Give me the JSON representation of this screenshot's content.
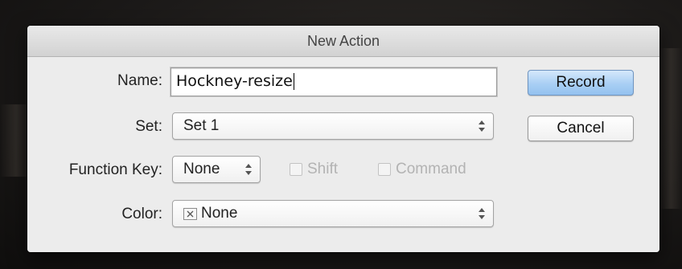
{
  "dialog": {
    "title": "New Action"
  },
  "name_field": {
    "label": "Name:",
    "value": "Hockney-resize"
  },
  "set_field": {
    "label": "Set:",
    "selected": "Set 1"
  },
  "function_key": {
    "label": "Function Key:",
    "selected": "None",
    "shift_label": "Shift",
    "shift_checked": false,
    "command_label": "Command",
    "command_checked": false
  },
  "color_field": {
    "label": "Color:",
    "selected": "None",
    "swatch_icon": "none-x-icon"
  },
  "buttons": {
    "record": "Record",
    "cancel": "Cancel"
  },
  "colors": {
    "default_button": "#a9cff4",
    "dialog_bg": "#ececec"
  }
}
